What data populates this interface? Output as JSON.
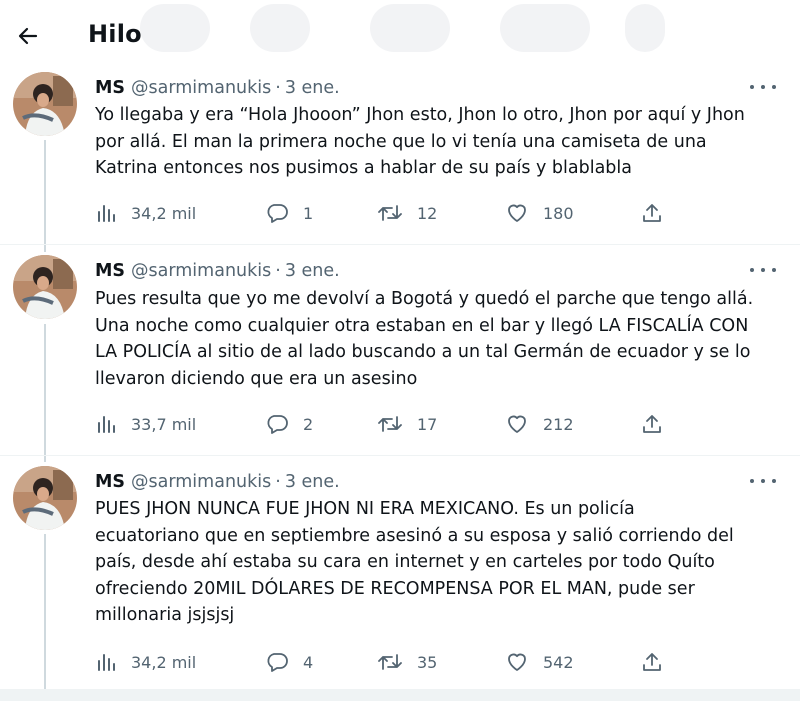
{
  "header": {
    "title": "Hilo",
    "back_icon": "arrow-left-icon"
  },
  "tweets": [
    {
      "name": "MS",
      "handle": "@sarmimanukis",
      "separator": "·",
      "date": "3 ene.",
      "lines": [
        "Yo llegaba y era “Hola Jhooon” Jhon esto, Jhon lo otro, Jhon por aquí y Jhon",
        "por allá. El man la primera noche que lo vi tenía una camiseta de una",
        "Katrina entonces nos pusimos a hablar de su país y blablabla"
      ],
      "views": "34,2 mil",
      "replies": "1",
      "retweets": "12",
      "likes": "180"
    },
    {
      "name": "MS",
      "handle": "@sarmimanukis",
      "separator": "·",
      "date": "3 ene.",
      "lines": [
        "Pues resulta que yo me devolví a Bogotá y quedó el parche que tengo allá.",
        "Una noche como cualquier otra estaban en el bar y llegó LA FISCALÍA CON",
        "LA POLICÍA al sitio de al lado buscando a un tal Germán de ecuador y se lo",
        "llevaron diciendo que era un asesino"
      ],
      "views": "33,7 mil",
      "replies": "2",
      "retweets": "17",
      "likes": "212"
    },
    {
      "name": "MS",
      "handle": "@sarmimanukis",
      "separator": "·",
      "date": "3 ene.",
      "lines": [
        "PUES JHON NUNCA FUE JHON NI ERA MEXICANO. Es un policía",
        "ecuatoriano que en septiembre asesinó a su esposa y salió corriendo del",
        "país, desde ahí estaba su cara en internet y en carteles por todo Quíto",
        "ofreciendo 20MIL DÓLARES DE RECOMPENSA POR EL MAN, pude ser",
        "millonaria jsjsjsj"
      ],
      "views": "34,2 mil",
      "replies": "4",
      "retweets": "35",
      "likes": "542"
    }
  ],
  "colors": {
    "text": "#0f1419",
    "secondary": "#536471",
    "line": "#cfd9de"
  },
  "icons": [
    "views-icon",
    "reply-icon",
    "retweet-icon",
    "like-icon",
    "share-icon",
    "more-icon"
  ]
}
